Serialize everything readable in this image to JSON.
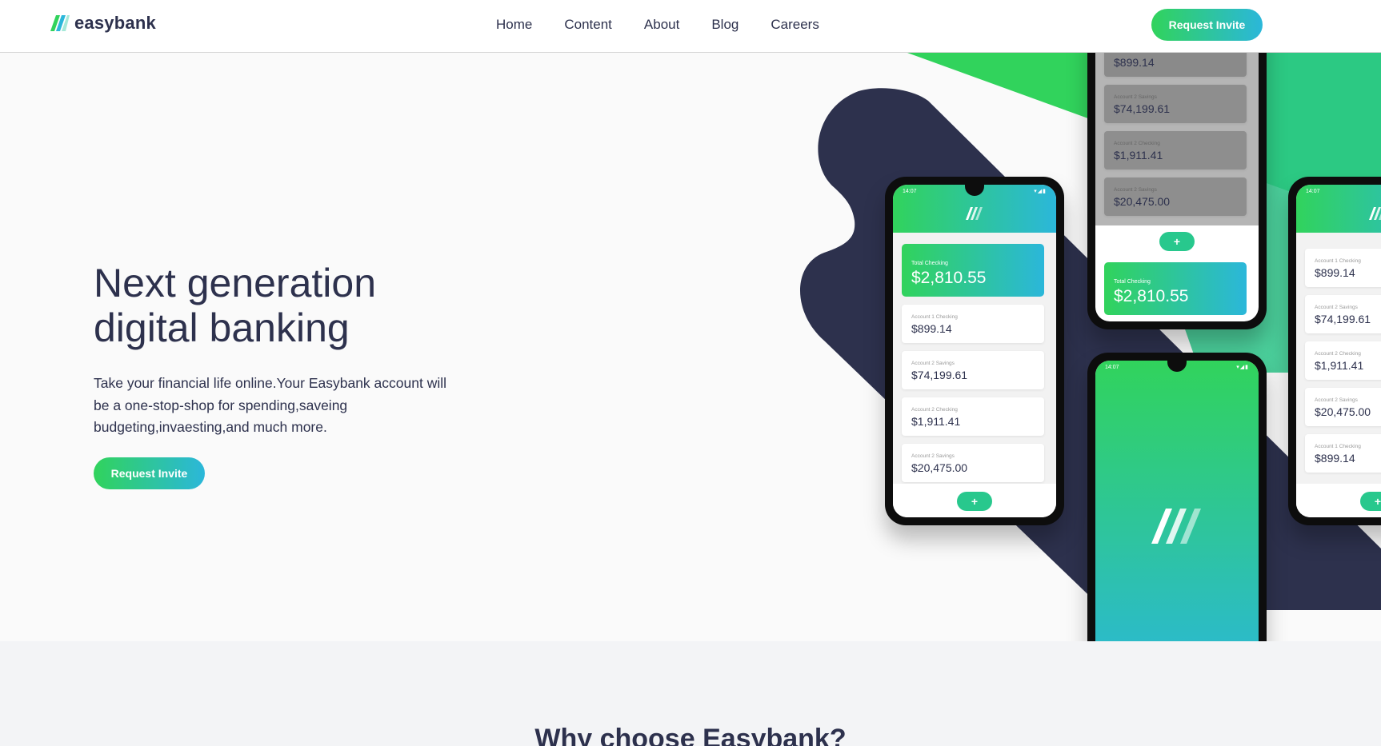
{
  "brand": {
    "name": "easybank"
  },
  "nav": {
    "items": [
      {
        "label": "Home"
      },
      {
        "label": "Content"
      },
      {
        "label": "About"
      },
      {
        "label": "Blog"
      },
      {
        "label": "Careers"
      }
    ],
    "cta_label": "Request Invite"
  },
  "hero": {
    "title_line1": "Next generation",
    "title_line2": "digital banking",
    "description": "Take your financial life online.Your Easybank account will be a one-stop-shop for spending,saveing budgeting,invaesting,and much more.",
    "cta_label": "Request Invite"
  },
  "section2": {
    "title": "Why choose Easybank?"
  },
  "phones": {
    "status_time": "14:07",
    "total_label": "Total Checking",
    "total_value": "$2,810.55",
    "fab_symbol": "+",
    "accounts": [
      {
        "label": "Account 1 Checking",
        "value": "$899.14"
      },
      {
        "label": "Account 2 Savings",
        "value": "$74,199.61"
      },
      {
        "label": "Account 2 Checking",
        "value": "$1,911.41"
      },
      {
        "label": "Account 2 Savings",
        "value": "$20,475.00"
      },
      {
        "label": "Account 1 Checking",
        "value": "$899.14"
      }
    ]
  },
  "colors": {
    "navy": "#2d314d",
    "green": "#31d35c",
    "cyan": "#2bb7da",
    "light_bg": "#fafafa"
  }
}
